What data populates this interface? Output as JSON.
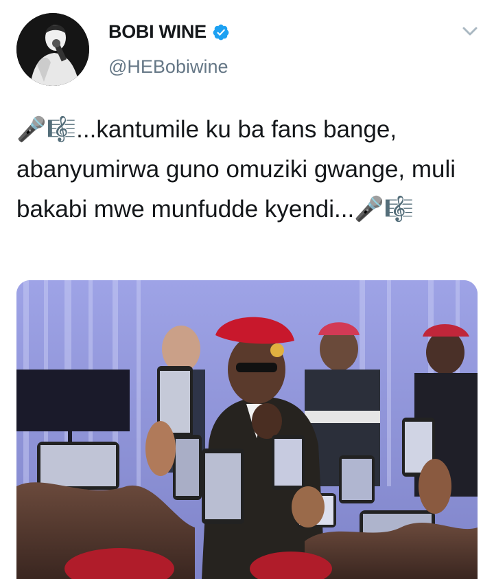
{
  "tweet": {
    "author": {
      "display_name": "BOBI WINE",
      "handle": "@HEBobiwine",
      "verified": true,
      "avatar_icon": "profile-photo-singing-microphone"
    },
    "text": "🎤🎼...kantumile ku ba fans bange, abanyumirwa guno omuziki gwange, muli bakabi mwe munfudde kyendi...🎤🎼",
    "media": {
      "type": "photo",
      "description_icon": "concert-photo-phones-recording"
    },
    "menu_icon": "chevron-down-icon"
  },
  "colors": {
    "text": "#14171a",
    "secondary": "#657786",
    "verified_badge": "#1da1f2",
    "chevron": "#aab8c2"
  }
}
